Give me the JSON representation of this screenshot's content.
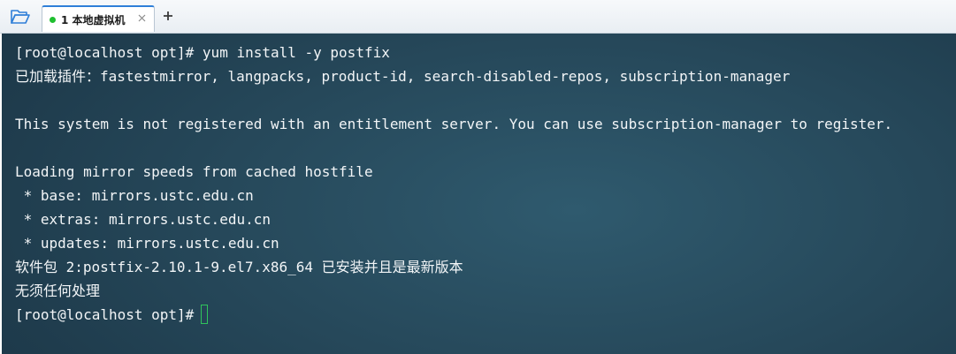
{
  "tabbar": {
    "folder_icon": "folder-open-icon",
    "tab": {
      "label": "1 本地虚拟机",
      "status_color": "#1fbf2f",
      "close_icon": "close-icon"
    },
    "add_icon": "plus-icon"
  },
  "terminal": {
    "background": "#26485a",
    "text_color": "#f2f5f7",
    "cursor_color": "#2fc45c",
    "lines": [
      "[root@localhost opt]# yum install -y postfix",
      "已加载插件：fastestmirror, langpacks, product-id, search-disabled-repos, subscription-manager",
      "",
      "This system is not registered with an entitlement server. You can use subscription-manager to register.",
      "",
      "Loading mirror speeds from cached hostfile",
      " * base: mirrors.ustc.edu.cn",
      " * extras: mirrors.ustc.edu.cn",
      " * updates: mirrors.ustc.edu.cn",
      "软件包 2:postfix-2.10.1-9.el7.x86_64 已安装并且是最新版本",
      "无须任何处理"
    ],
    "prompt": "[root@localhost opt]#"
  }
}
